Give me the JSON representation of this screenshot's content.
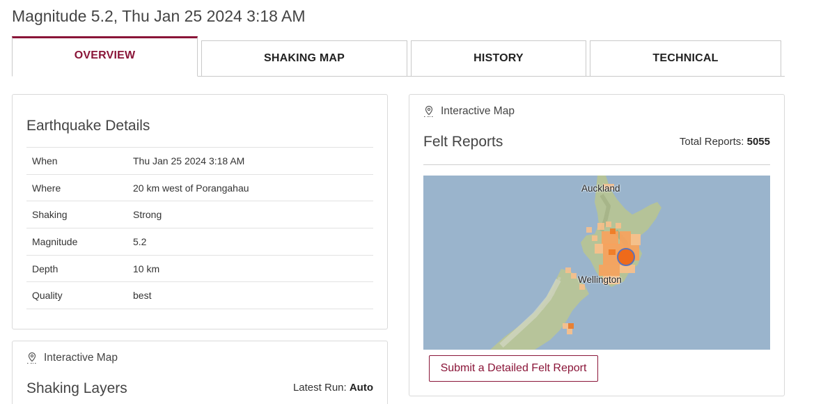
{
  "page": {
    "title": "Magnitude 5.2, Thu Jan 25 2024 3:18 AM"
  },
  "tabs": [
    {
      "label": "OVERVIEW",
      "active": true
    },
    {
      "label": "SHAKING MAP",
      "active": false
    },
    {
      "label": "HISTORY",
      "active": false
    },
    {
      "label": "TECHNICAL",
      "active": false
    }
  ],
  "details": {
    "title": "Earthquake Details",
    "rows": [
      {
        "label": "When",
        "value": "Thu Jan 25 2024 3:18 AM"
      },
      {
        "label": "Where",
        "value": "20 km west of Porangahau"
      },
      {
        "label": "Shaking",
        "value": "Strong"
      },
      {
        "label": "Magnitude",
        "value": "5.2"
      },
      {
        "label": "Depth",
        "value": "10 km"
      },
      {
        "label": "Quality",
        "value": "best"
      }
    ]
  },
  "shaking_layers": {
    "map_link": "Interactive Map",
    "title": "Shaking Layers",
    "latest_run_label": "Latest Run:",
    "latest_run_value": "Auto"
  },
  "felt_reports": {
    "map_link": "Interactive Map",
    "title": "Felt Reports",
    "total_label": "Total Reports:",
    "total_value": "5055",
    "map_labels": {
      "city_1": "Auckland",
      "city_2": "Wellington"
    },
    "submit_button": "Submit a Detailed Felt Report"
  },
  "colors": {
    "brand": "#8a1538",
    "sea": "#9ab4cc",
    "land": "#b7c49a",
    "felt_light": "#fbc08a",
    "felt_medium": "#f8a25c",
    "felt_strong": "#f07a23",
    "epicenter": "#ee6a1a"
  },
  "icons": {
    "map_link": "map-pin-icon"
  }
}
